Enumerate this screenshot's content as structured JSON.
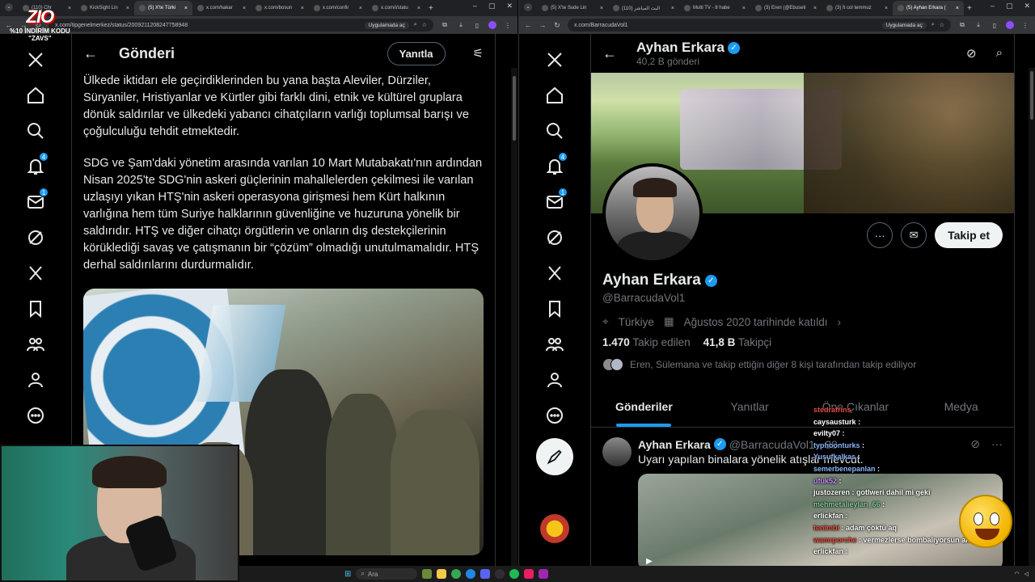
{
  "left_window": {
    "tabs": [
      {
        "label": "(110) Chr"
      },
      {
        "label": "KickSight Lin"
      },
      {
        "label": "(5) X'te Türki",
        "active": true
      },
      {
        "label": "x.com/hakar"
      },
      {
        "label": "x.com/bosun"
      },
      {
        "label": "x.com/confir"
      },
      {
        "label": "x.com/i/statu"
      }
    ],
    "url": "x.com/tipgenelmerkez/status/2009211208247758948",
    "app_pill": "Uygulamada aç",
    "header": {
      "title": "Gönderi",
      "reply_label": "Yanıtla"
    },
    "tweet": {
      "paragraphs": [
        "Ülkede iktidarı ele geçirdiklerinden bu yana başta Aleviler, Dürziler, Süryaniler, Hristiyanlar ve Kürtler gibi farklı dini, etnik ve kültürel gruplara dönük saldırılar ve ülkedeki yabancı cihatçıların varlığı toplumsal barışı ve çoğulculuğu tehdit etmektedir.",
        "SDG ve Şam'daki yönetim arasında varılan 10 Mart Mutabakatı'nın ardından Nisan 2025'te SDG'nin askeri güçlerinin mahallelerden çekilmesi ile varılan uzlaşıyı yıkan HTŞ'nin askeri operasyona girişmesi hem Kürt halkının varlığına hem tüm Suriye halklarının güvenliğine ve huzuruna yönelik bir saldırıdır. HTŞ ve diğer cihatçı örgütlerin ve onların dış destekçilerinin körüklediği savaş ve çatışmanın bir “çözüm” olmadığı unutulmamalıdır. HTŞ derhal saldırılarını durdurmalıdır."
      ]
    },
    "sidebar_badges": {
      "notifications": "4",
      "messages": "1"
    }
  },
  "overlay": {
    "logo": "ZIO",
    "promo_line1": "%10 İNDİRİM KODU",
    "promo_line2": "\"ZAVS\""
  },
  "right_window": {
    "tabs": [
      {
        "label": "(5) X'te Sude Lin"
      },
      {
        "label": "(110) البث المباشر"
      },
      {
        "label": "Multi TV - 8 habe"
      },
      {
        "label": "(3) Eren (@Ebuseli"
      },
      {
        "label": "(3) İt col temmuz"
      },
      {
        "label": "(5) Ayhan Erkara (",
        "active": true
      }
    ],
    "url": "x.com/BarracudaVol1",
    "app_pill": "Uygulamada aç",
    "sidebar_badges": {
      "notifications": "4",
      "messages": "1"
    },
    "profile": {
      "header_name": "Ayhan Erkara",
      "post_count": "40,2 B gönderi",
      "name": "Ayhan Erkara",
      "handle": "@BarracudaVol1",
      "location": "Türkiye",
      "joined": "Ağustos 2020 tarihinde katıldı",
      "following_count": "1.470",
      "following_label": "Takip edilen",
      "followers_count": "41,8 B",
      "followers_label": "Takipçi",
      "followed_by": "Eren, Sülemana ve takip ettiğin diğer 8 kişi tarafından takip ediliyor",
      "follow_label": "Takip et"
    },
    "tabs_profile": [
      "Gönderiler",
      "Yanıtlar",
      "Öne Çıkanlar",
      "Medya"
    ],
    "feed": {
      "name": "Ayhan Erkara",
      "handle": "@BarracudaVol1",
      "time": "· 38",
      "text": "Uyarı yapılan binalara yönelik atışlar mevcut."
    }
  },
  "chat": [
    {
      "user": "stedrafrins",
      "msg": "",
      "color": "#e74c3c"
    },
    {
      "user": "caysausturk",
      "msg": ":",
      "color": "#ffffff"
    },
    {
      "user": "evilty07",
      "msg": ":",
      "color": "#ffffff"
    },
    {
      "user": "typhoonturks",
      "msg": ":",
      "color": "#8ab4f8"
    },
    {
      "user": "Yusufkalkas",
      "msg": ":",
      "color": "#8ab4f8"
    },
    {
      "user": "semerbenepanlan",
      "msg": ":",
      "color": "#8ab4f8"
    },
    {
      "user": "ufuk52",
      "msg": ":",
      "color": "#c58af9"
    },
    {
      "user": "justozeren",
      "msg": ": gotlweri dahil mi geki",
      "color": "#ffffff"
    },
    {
      "user": "mehmetalieylan_66",
      "msg": ":",
      "color": "#81c995"
    },
    {
      "user": "erlickfan",
      "msg": ":",
      "color": "#ffffff"
    },
    {
      "user": "tenimbi",
      "msg": ": adam çöktü aq",
      "color": "#e74c3c"
    },
    {
      "user": "wamrporche",
      "msg": ": vermezlerse bombalıyorsun amk",
      "color": "#e74c3c"
    },
    {
      "user": "erlickfan",
      "msg": ":",
      "color": "#ffffff"
    }
  ],
  "taskbar": {
    "search_placeholder": "Ara"
  },
  "colors": {
    "accent": "#1d9bf0",
    "bg": "#000000",
    "text": "#e7e9ea",
    "muted": "#71767b"
  }
}
